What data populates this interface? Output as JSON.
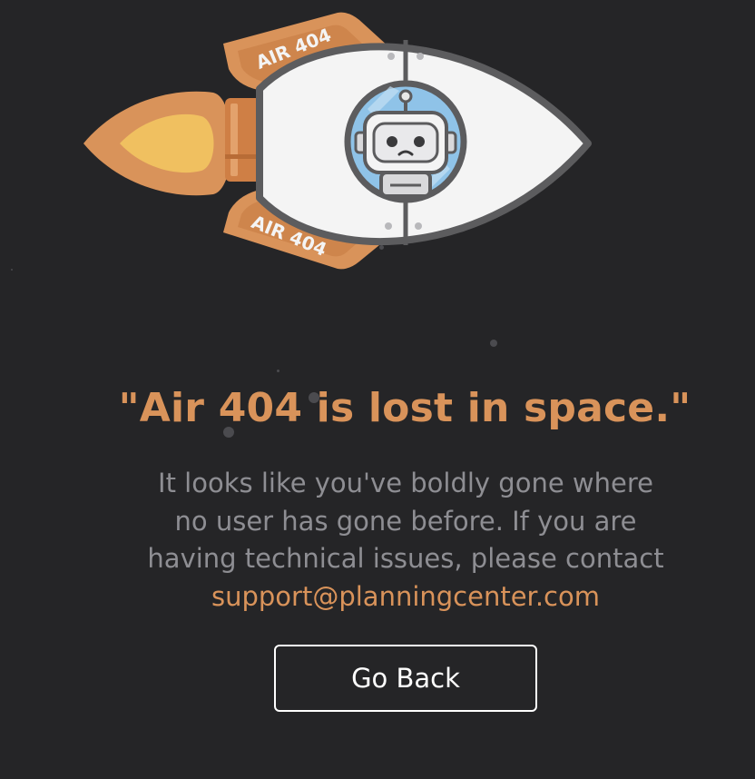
{
  "illustration": {
    "fin_top_label": "AIR 404",
    "fin_bottom_label": "AIR 404",
    "colors": {
      "orange": "#d9935a",
      "flame_inner": "#f0c060",
      "hull": "#f4f4f4",
      "outline": "#5c5c5e",
      "porthole": "#8fc3e8"
    }
  },
  "headline": "\"Air 404 is lost in space.\"",
  "message": {
    "line1": "It looks like you've boldly gone where",
    "line2": "no user has gone before. If you are",
    "line3": "having technical issues, please contact",
    "email": "support@planningcenter.com"
  },
  "actions": {
    "go_back_label": "Go Back"
  },
  "colors": {
    "background": "#252527",
    "accent": "#d9935a",
    "body_text": "#8e8e93",
    "button_border": "#ffffff"
  }
}
